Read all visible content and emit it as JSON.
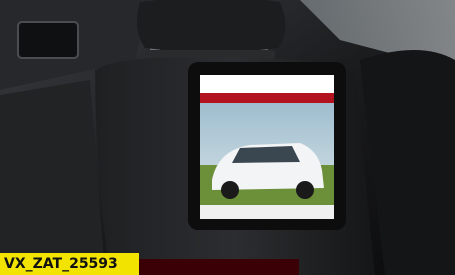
{
  "caption": {
    "text": "VX_ZAT_25593"
  },
  "colors": {
    "caption_background": "#f2e400",
    "caption_text": "#111111",
    "strip": "#3a0006"
  }
}
